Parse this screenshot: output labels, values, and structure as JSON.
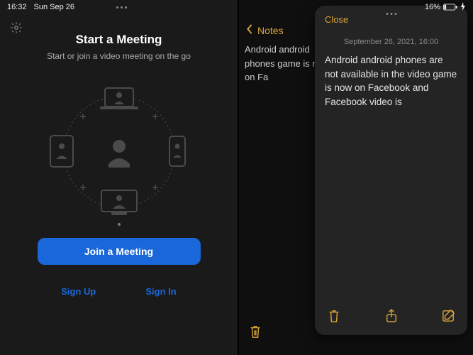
{
  "status": {
    "time": "16:32",
    "date": "Sun Sep 26",
    "battery_text": "16%"
  },
  "zoom": {
    "title": "Start a Meeting",
    "subtitle": "Start or join a video meeting on the go",
    "join_label": "Join a Meeting",
    "signup_label": "Sign Up",
    "signin_label": "Sign In"
  },
  "notes": {
    "back_label": "Notes",
    "behind_text": "Android android phones game is now on Fa"
  },
  "sheet": {
    "close_label": "Close",
    "date": "September 26, 2021, 16:00",
    "body": "Android android phones are not available in the video game is now on Facebook and Facebook video is"
  }
}
